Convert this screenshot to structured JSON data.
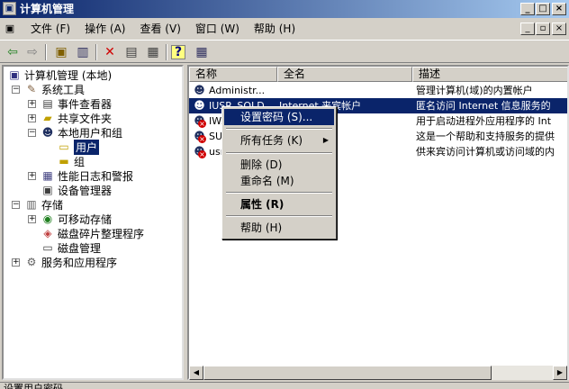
{
  "window": {
    "title": "计算机管理",
    "min": "_",
    "max": "□",
    "close": "×"
  },
  "menu": [
    {
      "label": "文件 (F)"
    },
    {
      "label": "操作 (A)"
    },
    {
      "label": "查看 (V)"
    },
    {
      "label": "窗口 (W)"
    },
    {
      "label": "帮助 (H)"
    }
  ],
  "mdi": {
    "min": "_",
    "restore": "▫",
    "close": "×"
  },
  "toolbar": {
    "back": "⇦",
    "forward": "⇨",
    "up": "▣",
    "tree": "▥",
    "delete": "✕",
    "properties": "▤",
    "export": "▦",
    "help": "?",
    "extra": "▦"
  },
  "tree": {
    "root": "计算机管理 (本地)",
    "system_tools": "系统工具",
    "event_viewer": "事件查看器",
    "shared_folders": "共享文件夹",
    "local_users": "本地用户和组",
    "users": "用户",
    "groups": "组",
    "perf_logs": "性能日志和警报",
    "device_manager": "设备管理器",
    "storage": "存储",
    "removable": "可移动存储",
    "defrag": "磁盘碎片整理程序",
    "disk_mgmt": "磁盘管理",
    "services": "服务和应用程序"
  },
  "list": {
    "columns": {
      "name": "名称",
      "fullname": "全名",
      "desc": "描述"
    },
    "rows": [
      {
        "name": "Administr...",
        "fullname": "",
        "desc": "管理计算机(域)的内置帐户",
        "disabled": false,
        "selected": false
      },
      {
        "name": "IUSR_SQLD...",
        "fullname": "Internet 来宾帐户",
        "desc": "匿名访问 Internet 信息服务的",
        "disabled": false,
        "selected": true
      },
      {
        "name": "IWA...",
        "fullname": "程序帐户",
        "desc": "用于启动进程外应用程序的 Int",
        "disabled": true,
        "selected": false
      },
      {
        "name": "SUP...",
        "fullname": "ft Corpora...",
        "desc": "这是一个帮助和支持服务的提供",
        "disabled": true,
        "selected": false
      },
      {
        "name": "usr...",
        "fullname": "",
        "desc": "供来宾访问计算机或访问域的内",
        "disabled": true,
        "selected": false
      }
    ]
  },
  "context_menu": {
    "set_password": "设置密码 (S)...",
    "all_tasks": "所有任务 (K)",
    "delete": "删除 (D)",
    "rename": "重命名 (M)",
    "properties": "属性 (R)",
    "help": "帮助 (H)",
    "arrow": "▶"
  },
  "status": {
    "text": "设置用户密码"
  }
}
